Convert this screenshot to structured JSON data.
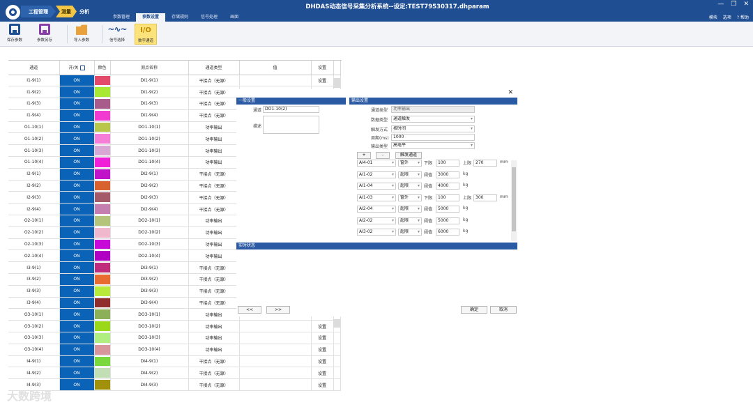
{
  "app": {
    "title": "DHDAS动态信号采集分析系统--设定:TEST79530317.dhparam",
    "steps": [
      "工程管理",
      "测量",
      "分析"
    ],
    "tabs": [
      "参数管理",
      "参数设置",
      "存储规则",
      "信号处理",
      "画面"
    ],
    "active_tab": "参数设置",
    "top_right": [
      "模块",
      "选项",
      "? 帮助"
    ],
    "win_controls": [
      "—",
      "❐",
      "✕"
    ]
  },
  "toolbar": {
    "save_label": "保存参数",
    "saveas_label": "参数另存",
    "import_label": "导入参数",
    "wave_label": "信号选择",
    "io_icon_text": "I/O",
    "io_label": "数字通道"
  },
  "grid": {
    "headers": [
      "通道",
      "开/关",
      "颜色",
      "测点名称",
      "通道类型",
      "值",
      "设置"
    ],
    "rows": [
      {
        "ch": "I1-9(1)",
        "on": "ON",
        "color": "#e44a6a",
        "name": "DI1-9(1)",
        "type": "干接点（无源）",
        "set": "设置"
      },
      {
        "ch": "I1-9(2)",
        "on": "ON",
        "color": "#a8e832",
        "name": "DI1-9(2)",
        "type": "干接点（无源）",
        "set": ""
      },
      {
        "ch": "I1-9(3)",
        "on": "ON",
        "color": "#a85c8c",
        "name": "DI1-9(3)",
        "type": "干接点（无源）",
        "set": ""
      },
      {
        "ch": "I1-9(4)",
        "on": "ON",
        "color": "#f03ad0",
        "name": "DI1-9(4)",
        "type": "干接点（无源）",
        "set": ""
      },
      {
        "ch": "O1-10(1)",
        "on": "ON",
        "color": "#b8c64c",
        "name": "DO1-10(1)",
        "type": "功率输出",
        "set": ""
      },
      {
        "ch": "O1-10(2)",
        "on": "ON",
        "color": "#f47ed8",
        "name": "DO1-10(2)",
        "type": "功率输出",
        "set": ""
      },
      {
        "ch": "O1-10(3)",
        "on": "ON",
        "color": "#d8a8d4",
        "name": "DO1-10(3)",
        "type": "功率输出",
        "set": ""
      },
      {
        "ch": "O1-10(4)",
        "on": "ON",
        "color": "#f020d8",
        "name": "DO1-10(4)",
        "type": "功率输出",
        "set": ""
      },
      {
        "ch": "I2-9(1)",
        "on": "ON",
        "color": "#c012c8",
        "name": "DI2-9(1)",
        "type": "干接点（无源）",
        "set": ""
      },
      {
        "ch": "I2-9(2)",
        "on": "ON",
        "color": "#d8622e",
        "name": "DI2-9(2)",
        "type": "干接点（无源）",
        "set": ""
      },
      {
        "ch": "I2-9(3)",
        "on": "ON",
        "color": "#a45a68",
        "name": "DI2-9(3)",
        "type": "干接点（无源）",
        "set": ""
      },
      {
        "ch": "I2-9(4)",
        "on": "ON",
        "color": "#c47eb0",
        "name": "DI2-9(4)",
        "type": "干接点（无源）",
        "set": ""
      },
      {
        "ch": "O2-10(1)",
        "on": "ON",
        "color": "#b4c47a",
        "name": "DO2-10(1)",
        "type": "功率输出",
        "set": ""
      },
      {
        "ch": "O2-10(2)",
        "on": "ON",
        "color": "#f0b8cc",
        "name": "DO2-10(2)",
        "type": "功率输出",
        "set": ""
      },
      {
        "ch": "O2-10(3)",
        "on": "ON",
        "color": "#c80ad8",
        "name": "DO2-10(3)",
        "type": "功率输出",
        "set": ""
      },
      {
        "ch": "O2-10(4)",
        "on": "ON",
        "color": "#b000c4",
        "name": "DO2-10(4)",
        "type": "功率输出",
        "set": ""
      },
      {
        "ch": "I3-9(1)",
        "on": "ON",
        "color": "#c02c7c",
        "name": "DI3-9(1)",
        "type": "干接点（无源）",
        "set": ""
      },
      {
        "ch": "I3-9(2)",
        "on": "ON",
        "color": "#e86c30",
        "name": "DI3-9(2)",
        "type": "干接点（无源）",
        "set": ""
      },
      {
        "ch": "I3-9(3)",
        "on": "ON",
        "color": "#b8ea3c",
        "name": "DI3-9(3)",
        "type": "干接点（无源）",
        "set": ""
      },
      {
        "ch": "I3-9(4)",
        "on": "ON",
        "color": "#902e2e",
        "name": "DI3-9(4)",
        "type": "干接点（无源）",
        "set": ""
      },
      {
        "ch": "O3-10(1)",
        "on": "ON",
        "color": "#8cb058",
        "name": "DO3-10(1)",
        "type": "功率输出",
        "set": ""
      },
      {
        "ch": "O3-10(2)",
        "on": "ON",
        "color": "#9cd81a",
        "name": "DO3-10(2)",
        "type": "功率输出",
        "set": "设置"
      },
      {
        "ch": "O3-10(3)",
        "on": "ON",
        "color": "#b0ee82",
        "name": "DO3-10(3)",
        "type": "功率输出",
        "set": "设置"
      },
      {
        "ch": "O3-10(4)",
        "on": "ON",
        "color": "#d8969c",
        "name": "DO3-10(4)",
        "type": "功率输出",
        "set": "设置"
      },
      {
        "ch": "I4-9(1)",
        "on": "ON",
        "color": "#7ad83c",
        "name": "DI4-9(1)",
        "type": "干接点（无源）",
        "set": "设置"
      },
      {
        "ch": "I4-9(2)",
        "on": "ON",
        "color": "#c2deb4",
        "name": "DI4-9(2)",
        "type": "干接点（无源）",
        "set": "设置"
      },
      {
        "ch": "I4-9(3)",
        "on": "ON",
        "color": "#a0900a",
        "name": "DI4-9(3)",
        "type": "干接点（无源）",
        "set": "设置"
      }
    ]
  },
  "dialog": {
    "close": "✕",
    "general_title": "一般设置",
    "output_title": "输出设置",
    "realtime_title": "实时状态",
    "channel_label": "通道",
    "channel_value": "DO1-10(2)",
    "desc_label": "描述",
    "fields": [
      {
        "label": "通道类型",
        "value": "功率输出"
      },
      {
        "label": "数据类型",
        "value": "通道触发"
      },
      {
        "label": "触发方式",
        "value": "按时间"
      },
      {
        "label": "周期(ms)",
        "value": "1000"
      },
      {
        "label": "输出类型",
        "value": "高电平"
      }
    ],
    "add_label": "+",
    "remove_label": "-",
    "trigger_channel_label": "触发通道",
    "rules": [
      {
        "ch": "AI4-01",
        "mode": "窗外",
        "l1": "下限",
        "v1": "100",
        "l2": "上限",
        "v2": "270",
        "unit": "mm"
      },
      {
        "ch": "AI1-02",
        "mode": "超限",
        "l1": "阈值",
        "v1": "3000",
        "l2": "",
        "v2": "",
        "unit": "kg"
      },
      {
        "ch": "AI1-04",
        "mode": "超限",
        "l1": "阈值",
        "v1": "4000",
        "l2": "",
        "v2": "",
        "unit": "kg"
      },
      {
        "ch": "AI1-03",
        "mode": "窗外",
        "l1": "下限",
        "v1": "100",
        "l2": "上限",
        "v2": "300",
        "unit": "mm"
      },
      {
        "ch": "AI2-04",
        "mode": "超限",
        "l1": "阈值",
        "v1": "5000",
        "l2": "",
        "v2": "",
        "unit": "kg"
      },
      {
        "ch": "AI2-02",
        "mode": "超限",
        "l1": "阈值",
        "v1": "5000",
        "l2": "",
        "v2": "",
        "unit": "kg"
      },
      {
        "ch": "AI3-02",
        "mode": "超限",
        "l1": "阈值",
        "v1": "6000",
        "l2": "",
        "v2": "",
        "unit": "kg"
      }
    ],
    "prev_label": "<<",
    "next_label": ">>",
    "ok_label": "确定",
    "cancel_label": "取消"
  },
  "watermark": "大数跨境"
}
